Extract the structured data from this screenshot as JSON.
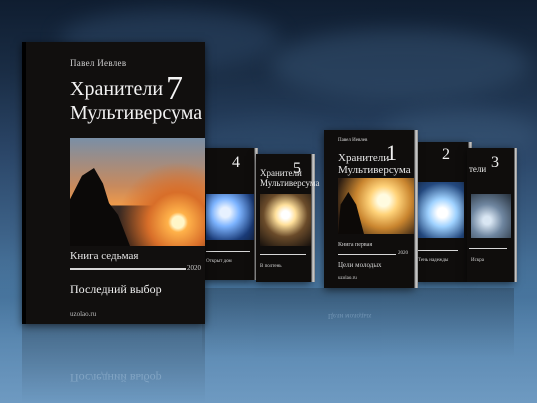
{
  "main_book": {
    "author": "Павел Иевлев",
    "title_line1": "Хранители",
    "title_line2": "Мультиверсума",
    "number": "7",
    "subtitle": "Книга седьмая",
    "year": "2020",
    "name": "Последний выбор",
    "site": "uzolao.ru"
  },
  "book1": {
    "author": "Павел Иевлев",
    "title_line1": "Хранители",
    "title_line2": "Мультиверсума",
    "number": "1",
    "subtitle": "Книга первая",
    "name": "Цели молодых",
    "year": "2020",
    "site": "uzolao.ru"
  },
  "book2": {
    "number": "2",
    "name": "Тень надежды"
  },
  "book3": {
    "title_line1": "тели",
    "number": "3",
    "name": "Искра"
  },
  "book4": {
    "number": "4",
    "name": "Открыт дом"
  },
  "book5": {
    "title_line1": "Хранители",
    "title_line2": "Мультиверсума",
    "number": "5",
    "name": "В полтень"
  },
  "colors": {
    "sky_top": "#0f1d30",
    "sky_bottom": "#6f9fc6",
    "cover": "#110f0e"
  }
}
